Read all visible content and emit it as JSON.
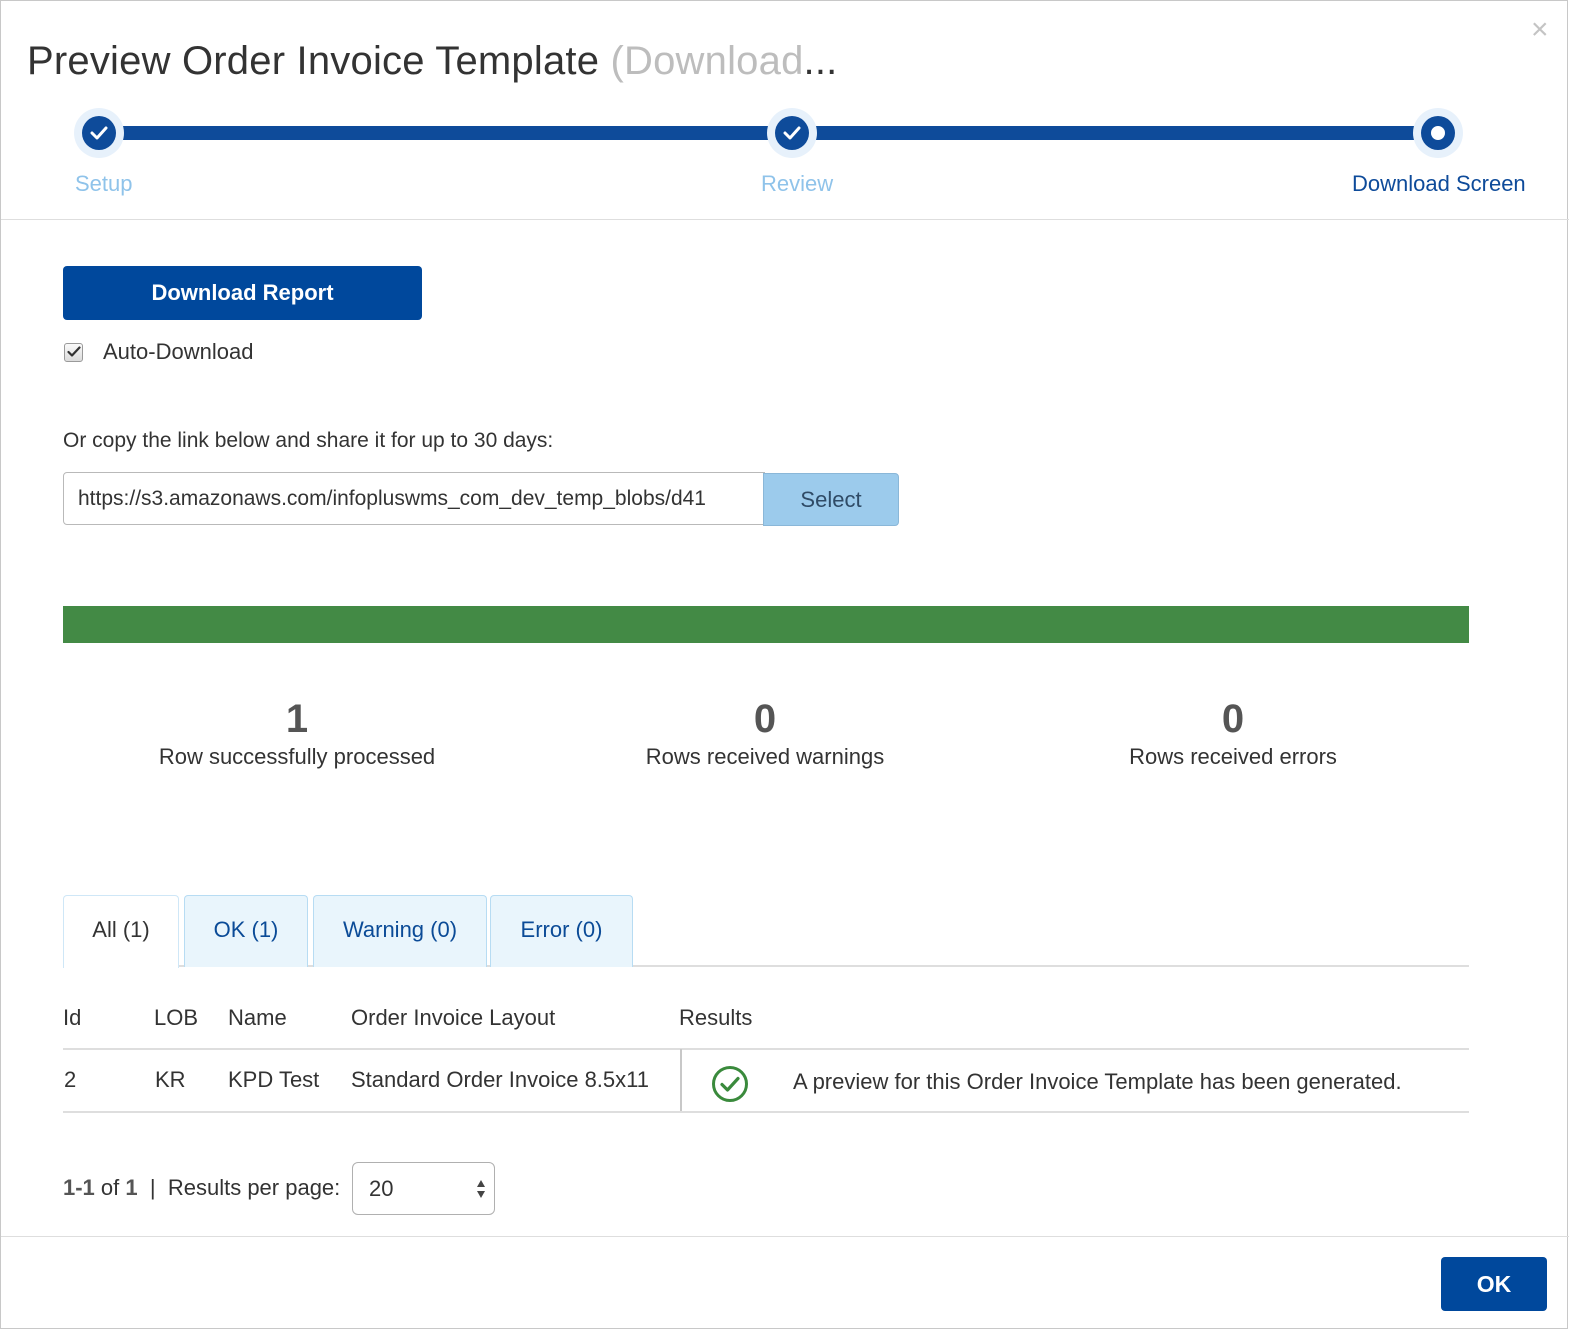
{
  "dialog": {
    "title": "Preview Order Invoice Template",
    "title_sub": "(Download",
    "title_ellipsis": "...",
    "close_glyph": "×"
  },
  "stepper": {
    "steps": [
      {
        "label": "Setup",
        "state": "done"
      },
      {
        "label": "Review",
        "state": "done"
      },
      {
        "label": "Download Screen",
        "state": "active"
      }
    ]
  },
  "download": {
    "button_label": "Download Report",
    "auto_download_label": "Auto-Download",
    "auto_download_checked": true,
    "copy_text": "Or copy the link below and share it for up to 30 days:",
    "link_value": "https://s3.amazonaws.com/infopluswms_com_dev_temp_blobs/d41",
    "select_label": "Select"
  },
  "progress": {
    "percent": 100,
    "color": "#438a45"
  },
  "stats": [
    {
      "value": "1",
      "label": "Row successfully processed"
    },
    {
      "value": "0",
      "label": "Rows received warnings"
    },
    {
      "value": "0",
      "label": "Rows received errors"
    }
  ],
  "tabs": [
    {
      "label": "All (1)",
      "active": true
    },
    {
      "label": "OK (1)",
      "active": false
    },
    {
      "label": "Warning (0)",
      "active": false
    },
    {
      "label": "Error (0)",
      "active": false
    }
  ],
  "table": {
    "columns": [
      "Id",
      "LOB",
      "Name",
      "Order Invoice Layout",
      "Results"
    ],
    "rows": [
      {
        "id": "2",
        "lob": "KR",
        "name": "KPD Test",
        "layout": "Standard Order Invoice 8.5x11",
        "result_icon": "check-circle-icon",
        "result_text": "A preview for this Order Invoice Template has been generated."
      }
    ]
  },
  "pager": {
    "range": "1-1",
    "of_word": "of",
    "total": "1",
    "separator": "|",
    "per_page_label": "Results per page:",
    "per_page_value": "20"
  },
  "footer": {
    "ok_label": "OK"
  },
  "colors": {
    "primary": "#00489c",
    "step_done_label": "#8fc3ea",
    "success": "#438a45"
  }
}
